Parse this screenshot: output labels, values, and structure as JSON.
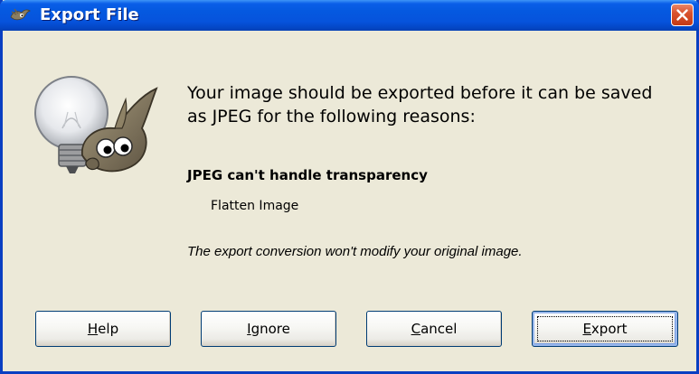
{
  "window": {
    "title": "Export File",
    "title_icon": "gimp-wilber-icon",
    "close_icon": "close-icon",
    "titlebar_color": "#0559E0",
    "close_color": "#D9532E"
  },
  "illustration": {
    "icon": "wilber-lightbulb-icon"
  },
  "content": {
    "message": "Your image should be exported before it can be saved as JPEG for the following reasons:",
    "reason_title": "JPEG can't handle transparency",
    "reason_action": "Flatten Image",
    "note": "The export conversion won't modify your original image."
  },
  "buttons": {
    "help": {
      "pre": "",
      "mnemonic": "H",
      "post": "elp"
    },
    "ignore": {
      "pre": "",
      "mnemonic": "I",
      "post": "gnore"
    },
    "cancel": {
      "pre": "",
      "mnemonic": "C",
      "post": "ancel"
    },
    "export": {
      "pre": "",
      "mnemonic": "E",
      "post": "xport"
    }
  }
}
